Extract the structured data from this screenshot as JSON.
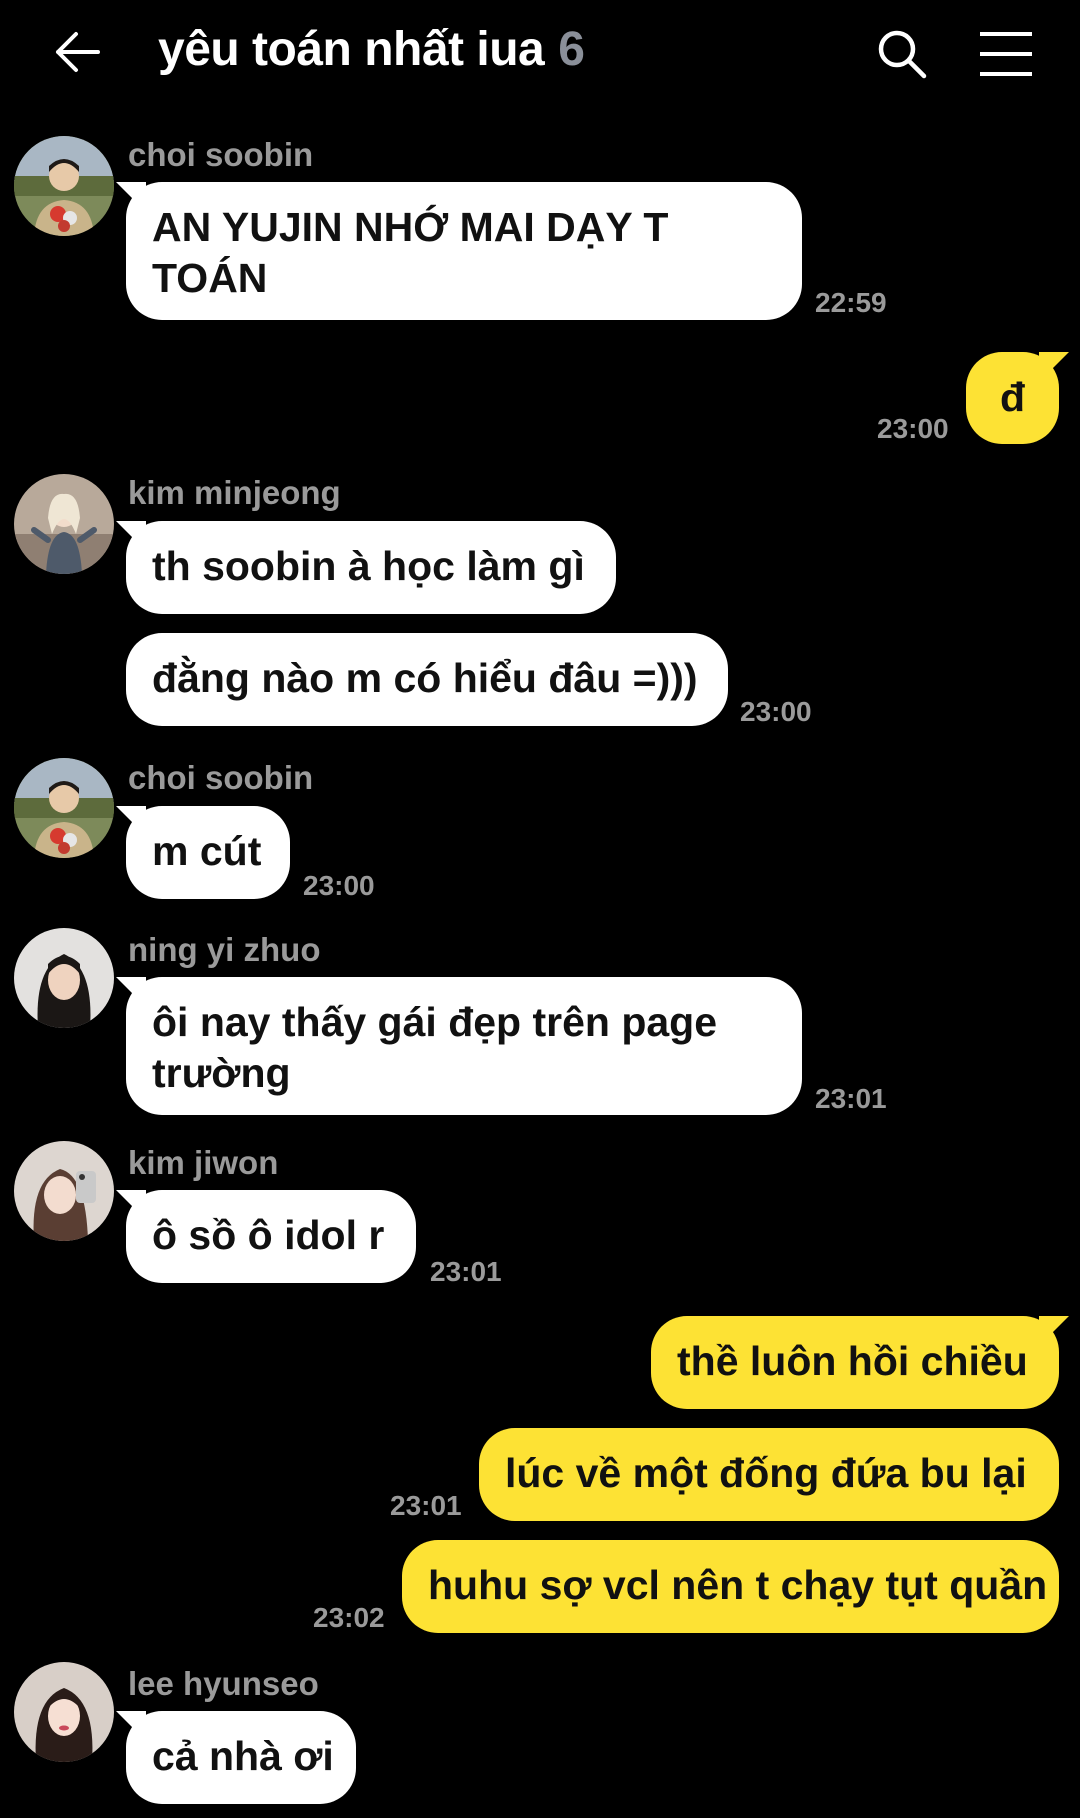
{
  "header": {
    "back_icon": "arrow-left-icon",
    "title": "yêu toán nhất iua",
    "member_count": "6",
    "search_icon": "search-icon",
    "menu_icon": "hamburger-menu-icon"
  },
  "messages": [
    {
      "sender": "choi soobin",
      "text": "AN YUJIN NHỚ MAI DẠY T TOÁN",
      "time": "22:59"
    },
    {
      "sender": "me",
      "text": "đ",
      "time": "23:00"
    },
    {
      "sender": "kim minjeong",
      "text": "th soobin à học làm gì"
    },
    {
      "sender": "kim minjeong",
      "text": "đằng nào m có hiểu đâu =)))",
      "time": "23:00"
    },
    {
      "sender": "choi soobin",
      "text": "m cút",
      "time": "23:00"
    },
    {
      "sender": "ning yi zhuo",
      "text": "ôi nay thấy gái đẹp trên page trường",
      "time": "23:01"
    },
    {
      "sender": "kim jiwon",
      "text": "ô sồ ô idol r",
      "time": "23:01"
    },
    {
      "sender": "me",
      "text": "thề luôn hồi chiều"
    },
    {
      "sender": "me",
      "text": "lúc về một đống đứa bu lại",
      "time": "23:01"
    },
    {
      "sender": "me",
      "text": "huhu sợ vcl nên t chạy tụt quần",
      "time": "23:02"
    },
    {
      "sender": "lee hyunseo",
      "text": "cả nhà ơi"
    }
  ],
  "colors": {
    "background": "#000000",
    "incoming_bubble": "#ffffff",
    "outgoing_bubble": "#fde234",
    "meta_text": "#9a9a9a"
  }
}
